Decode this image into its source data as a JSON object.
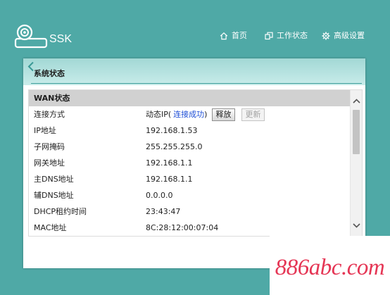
{
  "app": {
    "brand": "SSK",
    "logo_icon": "router-icon"
  },
  "nav": {
    "items": [
      {
        "label": "首页",
        "icon": "home-icon"
      },
      {
        "label": "工作状态",
        "icon": "status-icon"
      },
      {
        "label": "高级设置",
        "icon": "gear-icon"
      }
    ]
  },
  "panel": {
    "title": "系统状态",
    "back_icon": "chevron-left-icon"
  },
  "wan": {
    "title": "WAN状态",
    "connection": {
      "label": "连接方式",
      "value": "动态IP(",
      "status": "连接成功",
      "value_suffix": ")",
      "release_button": "释放",
      "renew_button": "更新",
      "renew_enabled": false
    },
    "rows": [
      {
        "label": "IP地址",
        "value": "192.168.1.53"
      },
      {
        "label": "子网掩码",
        "value": "255.255.255.0"
      },
      {
        "label": "网关地址",
        "value": "192.168.1.1"
      },
      {
        "label": "主DNS地址",
        "value": "192.168.1.1"
      },
      {
        "label": "辅DNS地址",
        "value": "0.0.0.0"
      },
      {
        "label": "DHCP租约时间",
        "value": "23:43:47"
      },
      {
        "label": "MAC地址",
        "value": "8C:28:12:00:07:04"
      }
    ]
  },
  "scrollbar": {
    "up_icon": "chevron-up-icon",
    "down_icon": "chevron-down-icon",
    "position": 0,
    "visible_fraction": 0.4
  },
  "watermark": "886abc.com",
  "colors": {
    "background": "#4fa9a6",
    "header_top": "#a2d8d5",
    "header_bottom": "#c9ecea",
    "accent": "#3f9f9c",
    "link": "#1f4fd6",
    "section_header": "#d1d1d1",
    "watermark": "#e53655"
  }
}
